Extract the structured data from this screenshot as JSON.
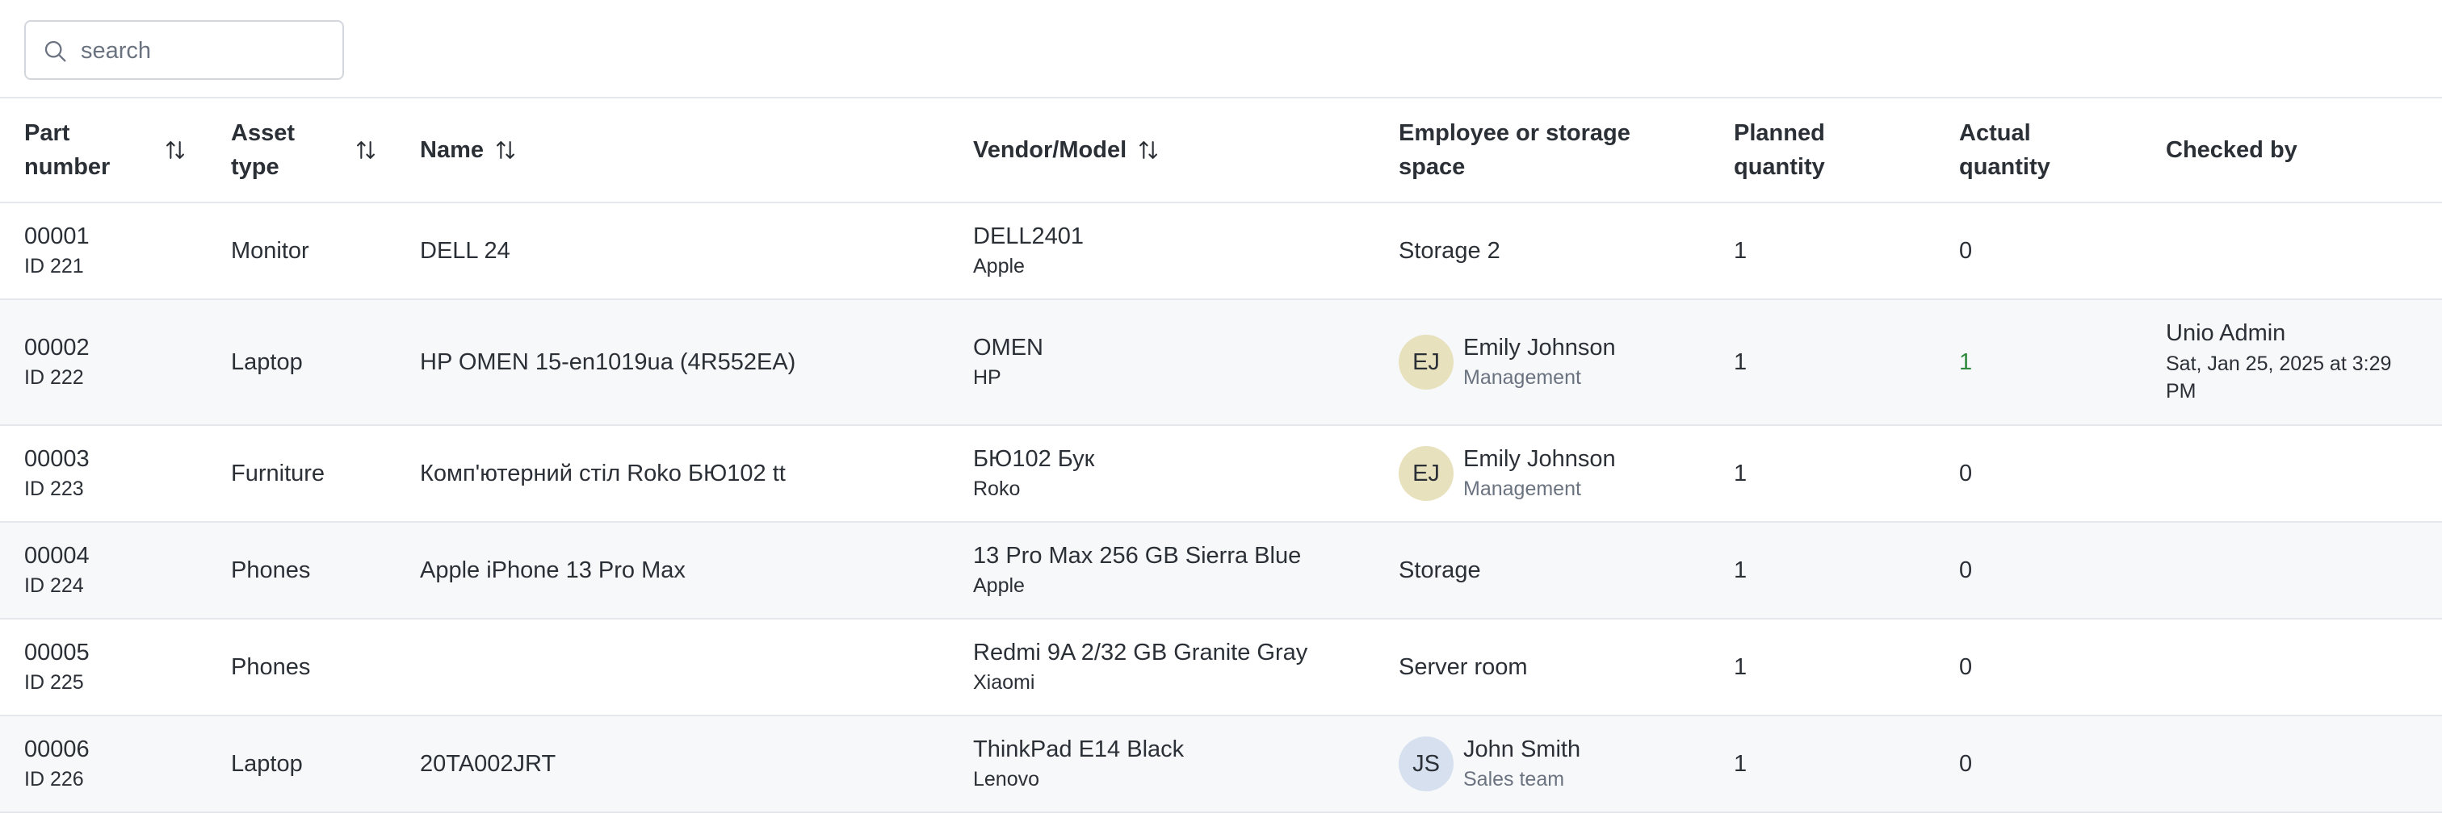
{
  "search": {
    "placeholder": "search"
  },
  "colors": {
    "border": "#e4e7eb",
    "row_alt": "#f7f8fa",
    "text": "#2b2f36",
    "muted": "#6b7380",
    "actual_highlight": "#2f8a3e",
    "avatar_ej": "#e8e1bd",
    "avatar_js": "#d6e0ee"
  },
  "table": {
    "headers": {
      "part_number": "Part number",
      "asset_type": "Asset type",
      "name": "Name",
      "vendor_model": "Vendor/Model",
      "employee": "Employee or storage space",
      "planned": "Planned quantity",
      "actual": "Actual quantity",
      "checked_by": "Checked by"
    },
    "rows": [
      {
        "part": "00001",
        "id": "ID 221",
        "type": "Monitor",
        "name": "DELL 24",
        "model": "DELL2401",
        "vendor": "Apple",
        "location": "Storage 2",
        "planned": "1",
        "actual": "0"
      },
      {
        "part": "00002",
        "id": "ID 222",
        "type": "Laptop",
        "name": "HP OMEN 15-en1019ua (4R552EA)",
        "model": "OMEN",
        "vendor": "HP",
        "emp_initials": "EJ",
        "emp_name": "Emily Johnson",
        "emp_dept": "Management",
        "planned": "1",
        "actual": "1",
        "checked_name": "Unio Admin",
        "checked_date": "Sat, Jan 25, 2025 at 3:29 PM"
      },
      {
        "part": "00003",
        "id": "ID 223",
        "type": "Furniture",
        "name": "Комп'ютерний стіл Roko БЮ102 tt",
        "model": "БЮ102 Бук",
        "vendor": "Roko",
        "emp_initials": "EJ",
        "emp_name": "Emily Johnson",
        "emp_dept": "Management",
        "planned": "1",
        "actual": "0"
      },
      {
        "part": "00004",
        "id": "ID 224",
        "type": "Phones",
        "name": "Apple iPhone 13 Pro Max",
        "model": "13 Pro Max 256 GB Sierra Blue",
        "vendor": "Apple",
        "location": "Storage",
        "planned": "1",
        "actual": "0"
      },
      {
        "part": "00005",
        "id": "ID 225",
        "type": "Phones",
        "name": "",
        "model": "Redmi 9A 2/32 GB Granite Gray",
        "vendor": "Xiaomi",
        "location": "Server room",
        "planned": "1",
        "actual": "0"
      },
      {
        "part": "00006",
        "id": "ID 226",
        "type": "Laptop",
        "name": "20TA002JRT",
        "model": "ThinkPad E14 Black",
        "vendor": "Lenovo",
        "emp_initials": "JS",
        "emp_name": "John Smith",
        "emp_dept": "Sales team",
        "planned": "1",
        "actual": "0"
      }
    ]
  }
}
